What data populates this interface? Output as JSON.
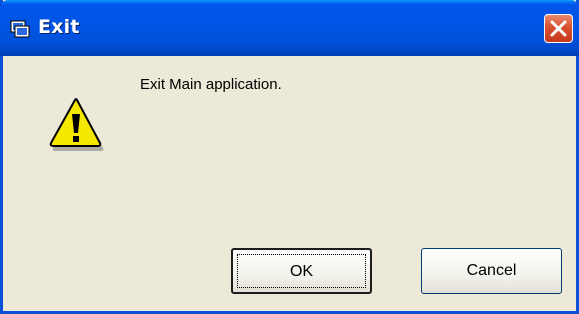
{
  "window": {
    "title": "Exit",
    "close_tooltip": "Close"
  },
  "dialog": {
    "message": "Exit Main application.",
    "icon": "warning-icon"
  },
  "buttons": {
    "ok_label": "OK",
    "cancel_label": "Cancel"
  },
  "colors": {
    "titlebar": "#0055e5",
    "close_button": "#d9512f",
    "dialog_background": "#ece9d8",
    "warning_yellow": "#f5e800"
  }
}
